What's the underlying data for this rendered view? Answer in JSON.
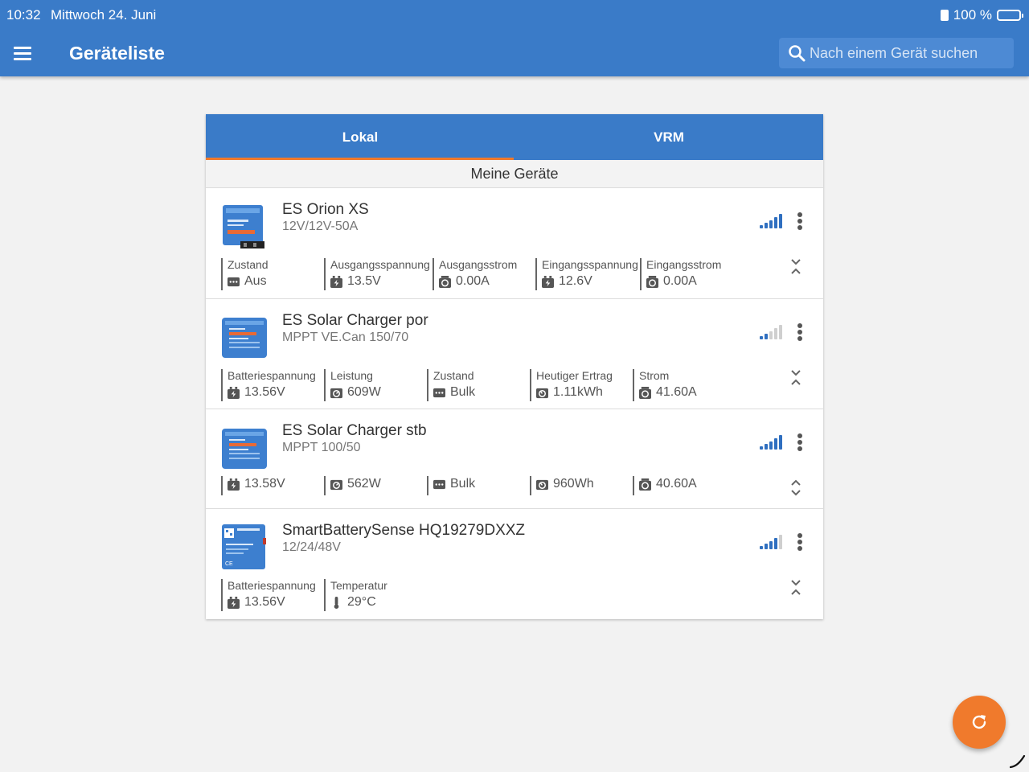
{
  "status_bar": {
    "time": "10:32",
    "date": "Mittwoch 24. Juni",
    "battery": "100 %"
  },
  "app_bar": {
    "title": "Geräteliste",
    "search_placeholder": "Nach einem Gerät suchen"
  },
  "tabs": [
    {
      "label": "Lokal",
      "active": true
    },
    {
      "label": "VRM",
      "active": false
    }
  ],
  "section_title": "Meine Geräte",
  "colors": {
    "brand_blue": "#3a7bc8",
    "accent_orange": "#f07a2c"
  },
  "devices": [
    {
      "name": "ES Orion XS",
      "model": "12V/12V-50A",
      "signal_bars": 5,
      "image": "orion-xs-image",
      "params": [
        {
          "label": "Zustand",
          "value": "Aus",
          "icon": "state-icon"
        },
        {
          "label": "Ausgangsspannung",
          "value": "13.5V",
          "icon": "battery-icon"
        },
        {
          "label": "Ausgangsstrom",
          "value": "0.00A",
          "icon": "current-icon"
        },
        {
          "label": "Eingangsspannung",
          "value": "12.6V",
          "icon": "battery-icon"
        },
        {
          "label": "Eingangsstrom",
          "value": "0.00A",
          "icon": "current-icon"
        }
      ]
    },
    {
      "name": "ES Solar Charger por",
      "model": "MPPT VE.Can 150/70",
      "signal_bars": 2,
      "image": "mppt-image",
      "params": [
        {
          "label": "Batteriespannung",
          "value": "13.56V",
          "icon": "battery-icon"
        },
        {
          "label": "Leistung",
          "value": "609W",
          "icon": "power-icon"
        },
        {
          "label": "Zustand",
          "value": "Bulk",
          "icon": "state-icon"
        },
        {
          "label": "Heutiger Ertrag",
          "value": "1.11kWh",
          "icon": "yield-icon"
        },
        {
          "label": "Strom",
          "value": "41.60A",
          "icon": "current-icon"
        }
      ]
    },
    {
      "name": "ES Solar Charger stb",
      "model": "MPPT 100/50",
      "signal_bars": 5,
      "image": "mppt-image",
      "params": [
        {
          "label": "",
          "value": "13.58V",
          "icon": "battery-icon"
        },
        {
          "label": "",
          "value": "562W",
          "icon": "power-icon"
        },
        {
          "label": "",
          "value": "Bulk",
          "icon": "state-icon"
        },
        {
          "label": "",
          "value": "960Wh",
          "icon": "yield-icon"
        },
        {
          "label": "",
          "value": "40.60A",
          "icon": "current-icon"
        }
      ]
    },
    {
      "name": "SmartBatterySense HQ19279DXXZ",
      "model": "12/24/48V",
      "signal_bars": 4,
      "image": "smart-battery-sense-image",
      "params": [
        {
          "label": "Batteriespannung",
          "value": "13.56V",
          "icon": "battery-icon"
        },
        {
          "label": "Temperatur",
          "value": "29°C",
          "icon": "thermometer-icon"
        }
      ]
    }
  ]
}
